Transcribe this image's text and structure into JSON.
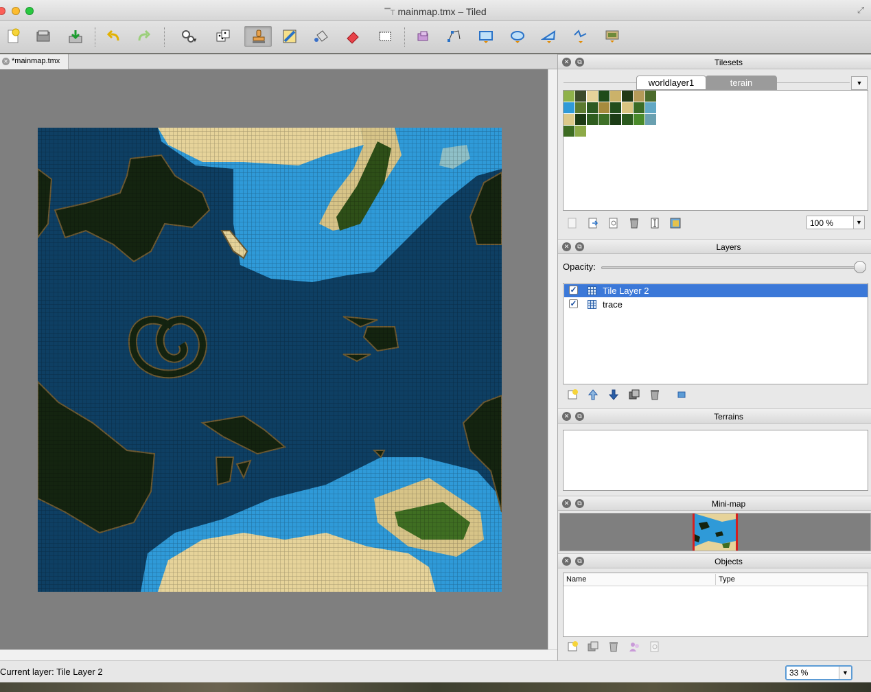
{
  "window": {
    "title": "mainmap.tmx – Tiled",
    "traffic_colors": {
      "close": "#fc5f57",
      "minimize": "#fdbc2e",
      "zoom": "#28c840"
    }
  },
  "toolbar": {
    "tools": [
      {
        "name": "new-file-icon",
        "tooltip": "New"
      },
      {
        "name": "open-file-icon",
        "tooltip": "Open"
      },
      {
        "name": "save-file-icon",
        "tooltip": "Save"
      },
      {
        "name": "undo-icon",
        "tooltip": "Undo"
      },
      {
        "name": "redo-icon",
        "tooltip": "Redo"
      },
      {
        "name": "commands-gear-icon",
        "tooltip": "Commands"
      },
      {
        "name": "random-dice-icon",
        "tooltip": "Random Mode"
      },
      {
        "name": "stamp-brush-icon",
        "tooltip": "Stamp Brush"
      },
      {
        "name": "terrain-brush-icon",
        "tooltip": "Terrain Brush"
      },
      {
        "name": "bucket-fill-icon",
        "tooltip": "Bucket Fill"
      },
      {
        "name": "eraser-icon",
        "tooltip": "Eraser"
      },
      {
        "name": "rect-select-icon",
        "tooltip": "Rectangular Select"
      },
      {
        "name": "select-objects-icon",
        "tooltip": "Select Objects"
      },
      {
        "name": "edit-polygons-icon",
        "tooltip": "Edit Polygons"
      },
      {
        "name": "insert-rectangle-icon",
        "tooltip": "Insert Rectangle"
      },
      {
        "name": "insert-ellipse-icon",
        "tooltip": "Insert Ellipse"
      },
      {
        "name": "insert-polygon-icon",
        "tooltip": "Insert Polygon"
      },
      {
        "name": "insert-polyline-icon",
        "tooltip": "Insert Polyline"
      },
      {
        "name": "insert-tile-icon",
        "tooltip": "Insert Tile"
      }
    ],
    "active_tool": "stamp-brush-icon"
  },
  "document_tabs": [
    {
      "label": "*mainmap.tmx"
    }
  ],
  "panels": {
    "tilesets": {
      "title": "Tilesets",
      "tabs": [
        "worldlayer1",
        "terain"
      ],
      "active_tab": "terain",
      "zoom": "100 %"
    },
    "layers": {
      "title": "Layers",
      "opacity_label": "Opacity:",
      "opacity": 1.0,
      "items": [
        {
          "name": "Tile Layer 2",
          "visible": true,
          "selected": true
        },
        {
          "name": "trace",
          "visible": true,
          "selected": false
        }
      ]
    },
    "terrains": {
      "title": "Terrains"
    },
    "minimap": {
      "title": "Mini-map"
    },
    "objects": {
      "title": "Objects",
      "columns": [
        "Name",
        "Type"
      ]
    }
  },
  "status": {
    "current_layer": "Current layer: Tile Layer 2",
    "zoom": "33 %"
  },
  "colors": {
    "deep_water": "#0e3f63",
    "shallow_water": "#2f9ad8",
    "sand": "#e6d39a",
    "land_dark": "#142410",
    "grass": "#3f6e22",
    "selection": "#3b78d8"
  }
}
